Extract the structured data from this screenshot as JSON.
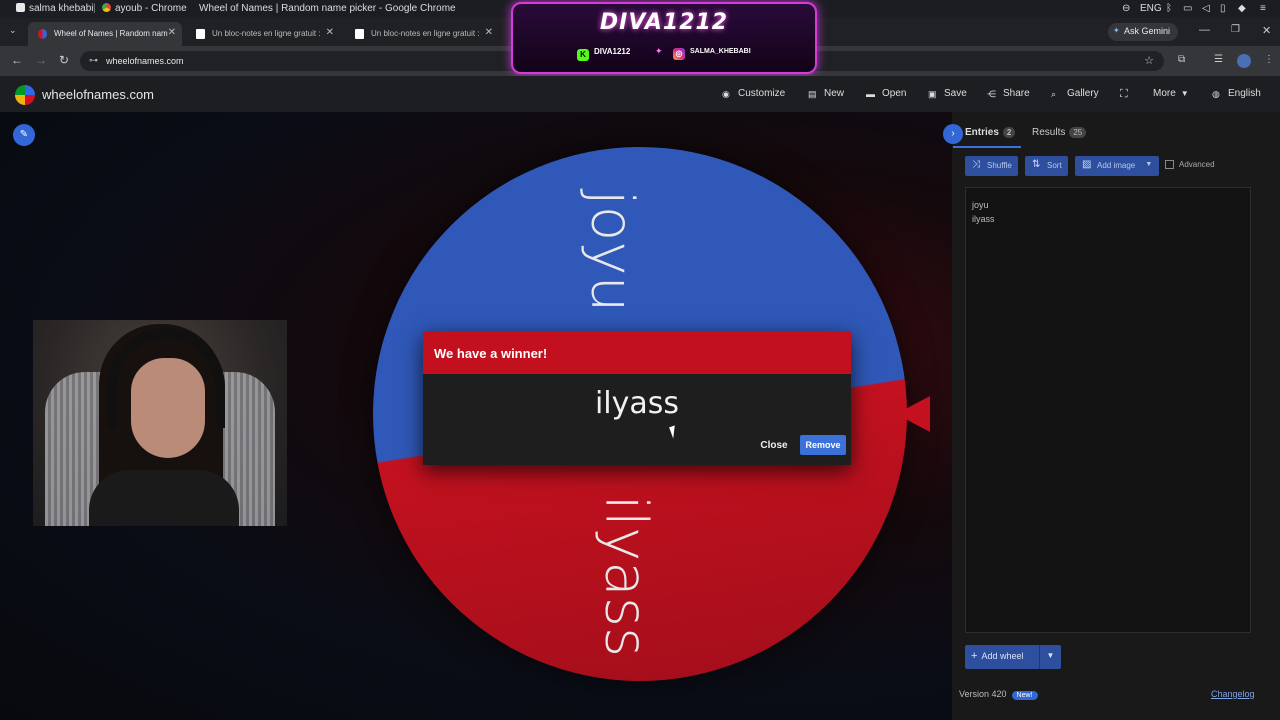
{
  "os_bar": {
    "user": "salma khebabi",
    "chrome_profile": "ayoub - Chrome",
    "window_title": "Wheel of Names | Random name picker - Google Chrome",
    "lang": "ENG"
  },
  "browser": {
    "tabs": [
      {
        "label": "Wheel of Names | Random nam"
      },
      {
        "label": "Un bloc-notes en ligne gratuit :"
      },
      {
        "label": "Un bloc-notes en ligne gratuit :"
      }
    ],
    "ask_gemini": "Ask Gemini",
    "url": "wheelofnames.com"
  },
  "overlay": {
    "title": "DIVA1212",
    "kick_handle": "DIVA1212",
    "instagram_handle": "SALMA_KHEBABI"
  },
  "site": {
    "name": "wheelofnames.com",
    "menu": [
      {
        "label": "Customize",
        "icon": "palette-icon"
      },
      {
        "label": "New",
        "icon": "new-file-icon"
      },
      {
        "label": "Open",
        "icon": "folder-icon"
      },
      {
        "label": "Save",
        "icon": "save-icon"
      },
      {
        "label": "Share",
        "icon": "share-icon"
      },
      {
        "label": "Gallery",
        "icon": "search-icon"
      },
      {
        "label": "More",
        "icon": "chevron-down-icon"
      },
      {
        "label": "English",
        "icon": "globe-icon"
      }
    ]
  },
  "wheel": {
    "segments": [
      {
        "label": "joyu",
        "color": "#2f58b8"
      },
      {
        "label": "ilyass",
        "color": "#c3111f"
      }
    ]
  },
  "winner_dialog": {
    "title": "We have a winner!",
    "winner": "ilyass",
    "close_label": "Close",
    "remove_label": "Remove"
  },
  "panel": {
    "tabs": {
      "entries_label": "Entries",
      "entries_count": "2",
      "results_label": "Results",
      "results_count": "25"
    },
    "toolbar": {
      "shuffle": "Shuffle",
      "sort": "Sort",
      "add_image": "Add image",
      "advanced": "Advanced"
    },
    "entries": [
      "joyu",
      "ilyass"
    ],
    "add_wheel": "Add wheel",
    "version": "Version 420",
    "new_badge": "New!",
    "changelog": "Changelog"
  },
  "colors": {
    "accent": "#3367d6",
    "winner_header": "#c3101f"
  }
}
